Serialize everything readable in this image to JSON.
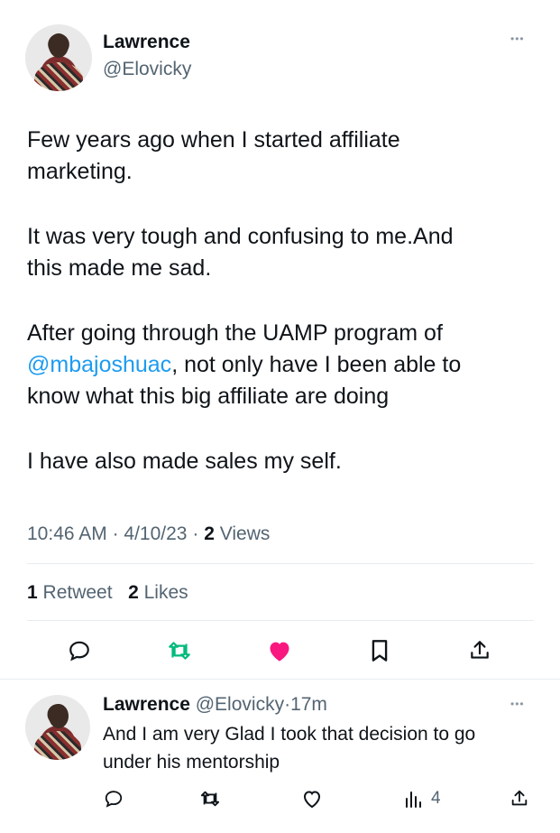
{
  "main_tweet": {
    "author_name": "Lawrence",
    "author_handle": "@Elovicky",
    "paragraphs": [
      {
        "line1": "Few years ago when I started affiliate",
        "line2": "marketing."
      },
      {
        "line1": "It was very tough and confusing to me.And",
        "line2": "this made me sad."
      },
      {
        "line1": "After going through the UAMP program of",
        "mention": "@mbajoshuac",
        "after_mention": ", not only have I been able to",
        "line3": "know what this big affiliate are doing"
      },
      {
        "line1": "I have also made sales my self."
      }
    ],
    "time": "10:46 AM",
    "date": "4/10/23",
    "views_count": "2",
    "views_label": "Views",
    "retweets_count": "1",
    "retweets_label": "Retweet",
    "likes_count": "2",
    "likes_label": "Likes",
    "actions": [
      "reply-icon",
      "retweet-icon",
      "like-icon",
      "bookmark-icon",
      "share-icon"
    ],
    "colors": {
      "retweet": "#00ba7c",
      "like": "#f91880",
      "link": "#1d9bf0"
    }
  },
  "reply_tweet": {
    "author_name": "Lawrence",
    "author_handle": "@Elovicky",
    "age": "17m",
    "line1": "And I am very Glad I took that decision to go",
    "line2": "under his mentorship",
    "views_count": "4",
    "actions": [
      "reply-icon",
      "retweet-icon",
      "like-icon",
      "views-icon",
      "share-icon"
    ]
  },
  "separator": "·",
  "more_glyph": "•••"
}
